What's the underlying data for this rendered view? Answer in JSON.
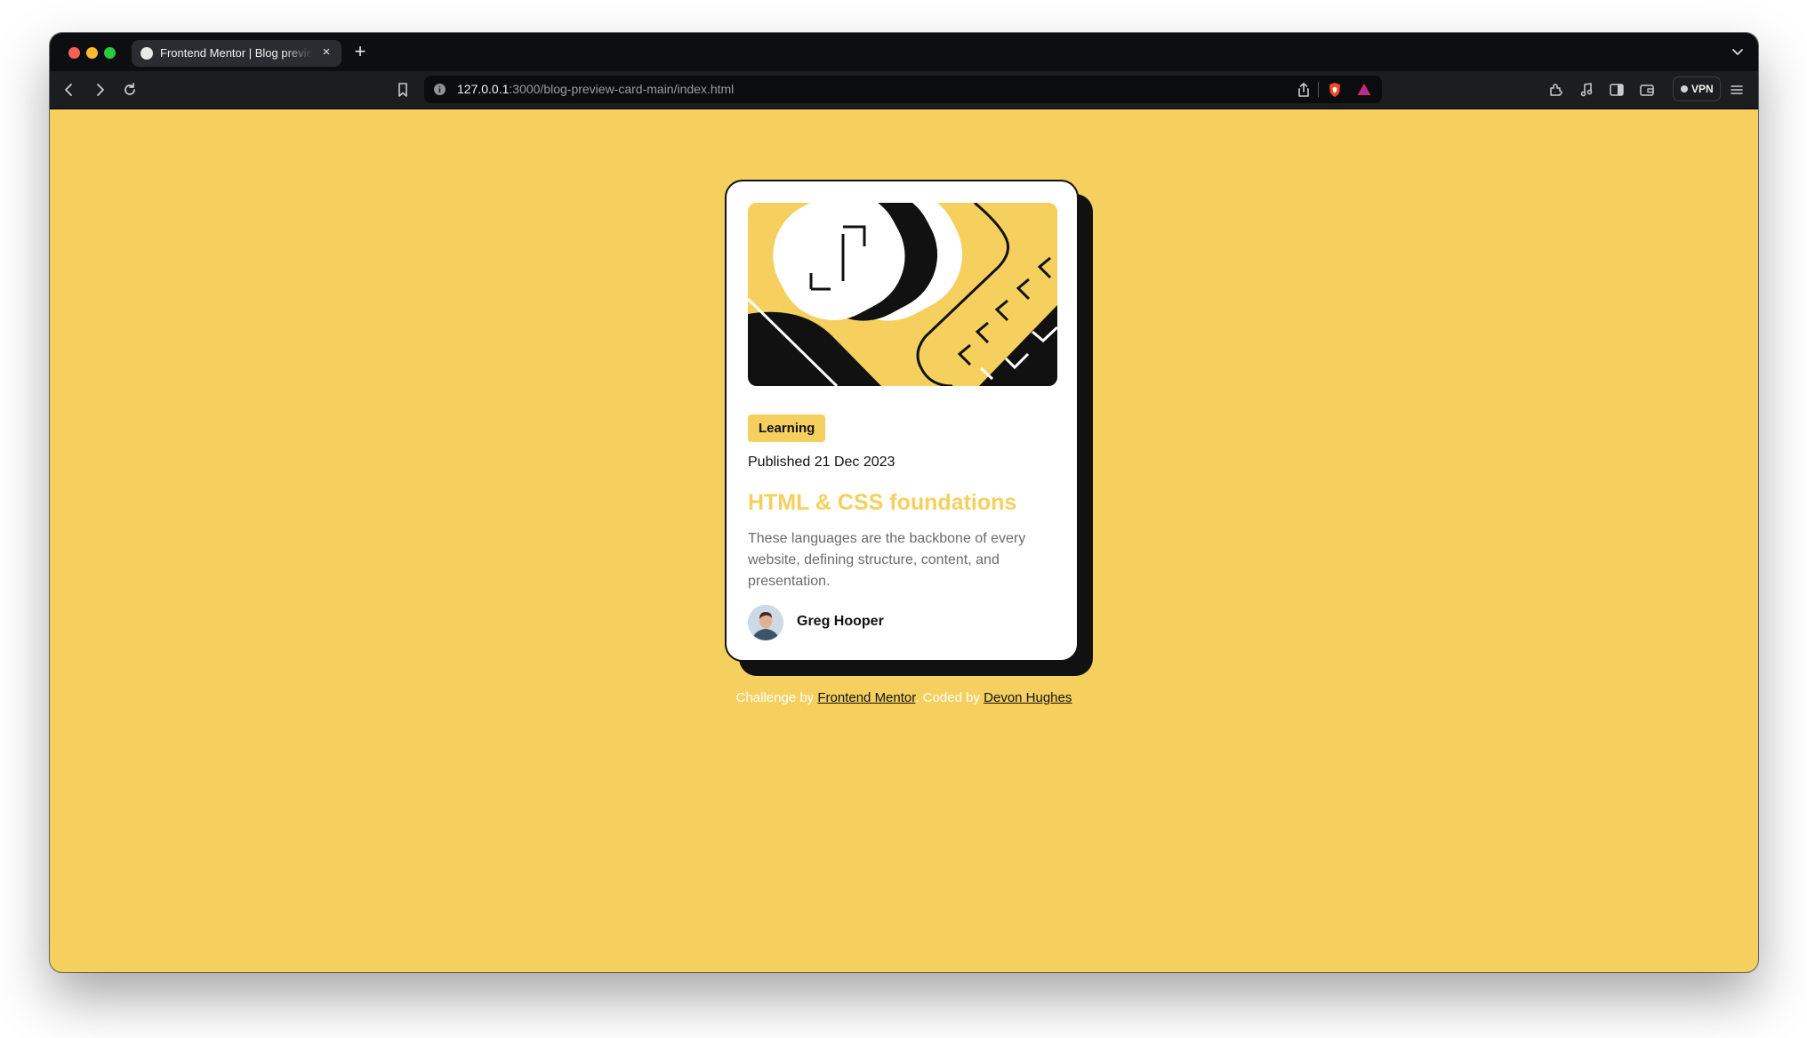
{
  "browser": {
    "tab_title": "Frontend Mentor | Blog preview card",
    "tab_close": "×",
    "new_tab": "+",
    "url_host": "127.0.0.1",
    "url_rest": ":3000/blog-preview-card-main/index.html",
    "vpn_label": "VPN"
  },
  "card": {
    "badge": "Learning",
    "published": "Published 21 Dec 2023",
    "title": "HTML & CSS foundations",
    "description": "These languages are the backbone of every website, defining structure, content, and presentation.",
    "author": "Greg Hooper"
  },
  "footer": {
    "challenge_prefix": "Challenge by",
    "challenge_link": "Frontend Mentor",
    "coded_prefix": ". Coded by",
    "coded_link": "Devon Hughes"
  },
  "colors": {
    "page_bg": "#f5d05e",
    "ink": "#111111",
    "accent": "#f5d05e"
  }
}
